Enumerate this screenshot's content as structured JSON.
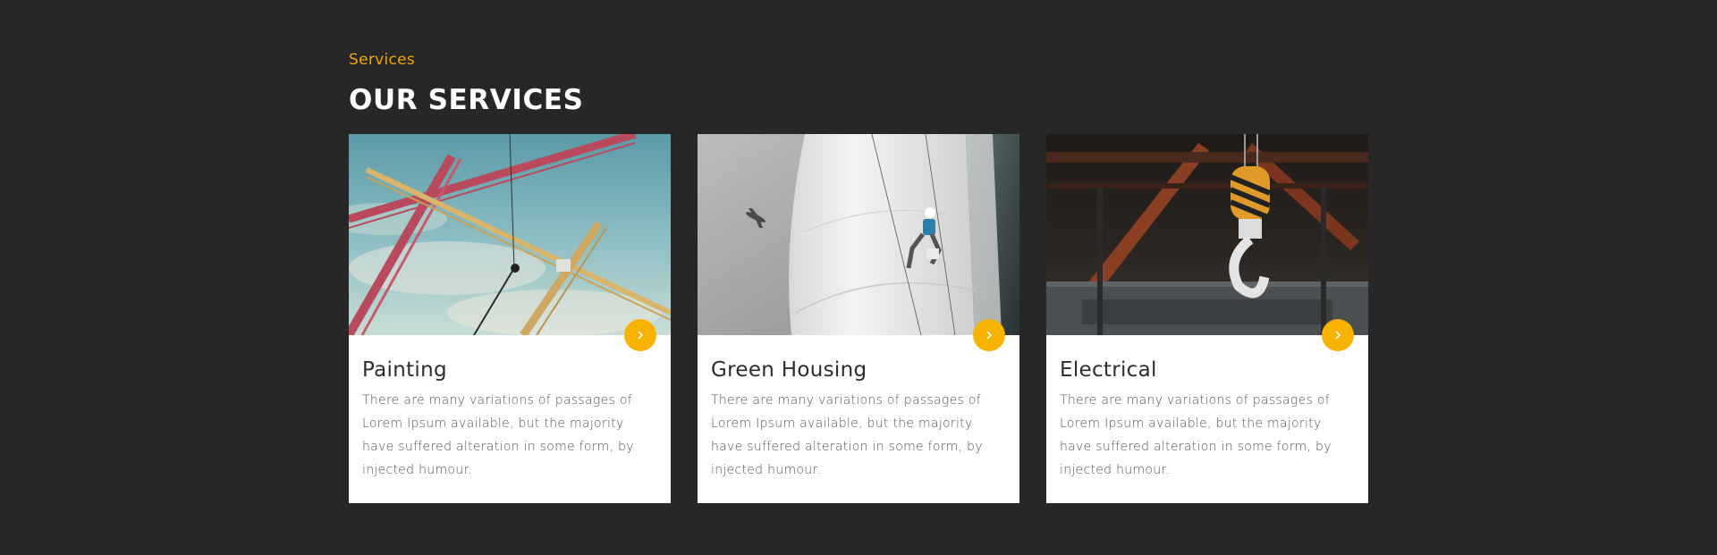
{
  "section": {
    "eyebrow": "Services",
    "title": "OUR SERVICES"
  },
  "cards": [
    {
      "title": "Painting",
      "text": "There are many variations of passages of Lorem Ipsum available, but the majority have suffered alteration in some form, by injected humour.",
      "image_subject": "tower-cranes-against-sky",
      "button_icon": "chevron-right-icon"
    },
    {
      "title": "Green Housing",
      "text": "There are many variations of passages of Lorem Ipsum available, but the majority have suffered alteration in some form, by injected humour.",
      "image_subject": "rope-access-worker-on-white-tower",
      "button_icon": "chevron-right-icon"
    },
    {
      "title": "Electrical",
      "text": "There are many variations of passages of Lorem Ipsum available, but the majority have suffered alteration in some form, by injected humour.",
      "image_subject": "crane-hook-in-industrial-hall",
      "button_icon": "chevron-right-icon"
    }
  ],
  "colors": {
    "background": "#272727",
    "accent": "#f5a50a",
    "button": "#f8b200",
    "card": "#ffffff"
  }
}
